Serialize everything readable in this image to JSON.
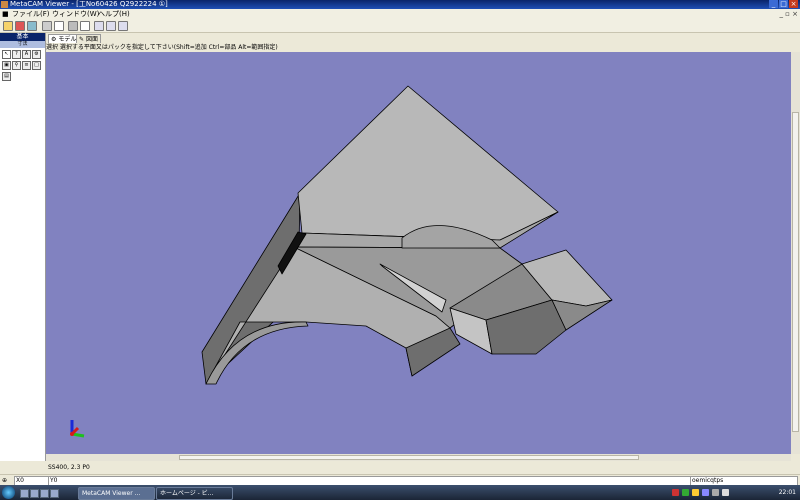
{
  "window": {
    "title": "MetaCAM Viewer - [工No60426 Q2922224 ①]",
    "buttons": [
      "_",
      "□",
      "×"
    ]
  },
  "menu": {
    "items": [
      "ファイル(F)",
      "ウィンドウ(W)",
      "ヘルプ(H)"
    ],
    "mdi_buttons": "_ ▫ ×"
  },
  "toolbar": {
    "icons": [
      "open-icon",
      "save-icon",
      "print-icon",
      "copy-icon",
      "zoom-icon",
      "measure-icon",
      "rotate-icon"
    ]
  },
  "left_panel": {
    "header": "基本",
    "subheader": "寸法",
    "icons": [
      "select-arrow-icon",
      "help-pointer-icon",
      "text-icon",
      "gear-icon",
      "view-icon",
      "search-icon",
      "list-icon",
      "folder-icon",
      "layers-icon"
    ]
  },
  "tabs": [
    {
      "label": "モデル",
      "icon": "model-icon"
    },
    {
      "label": "図面",
      "icon": "drawing-icon"
    }
  ],
  "hint": "選択  選択する平面又はパックを指定して下さい(Shift=追加 Ctrl=部品 Alt=範囲指定)",
  "viewport": {
    "background": "#8182c0",
    "part_colors": {
      "light": "#b8b8b8",
      "mid": "#9a9a9a",
      "dark": "#6e6e6e",
      "edge": "#000000"
    }
  },
  "status": {
    "material": "SS400, 2.3 P0"
  },
  "coords": {
    "x_label": "X0",
    "y_label": "Y0",
    "printer": "oemicqtps"
  },
  "taskbar": {
    "tasks": [
      {
        "label": "MetaCAM Viewer ...",
        "active": true
      },
      {
        "label": "ホームページ - ビ...",
        "active": false
      }
    ],
    "clock": "22:01"
  }
}
